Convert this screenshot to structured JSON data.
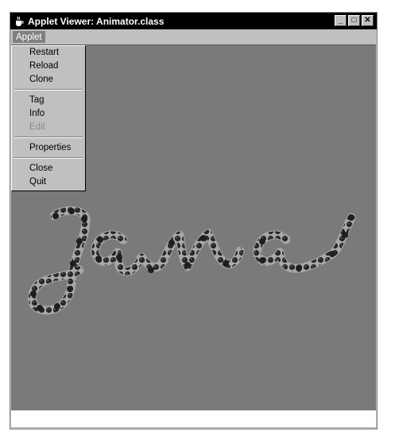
{
  "window": {
    "title": "Applet Viewer: Animator.class",
    "icon": "java-cup-icon",
    "controls": {
      "minimize": "_",
      "maximize": "□",
      "close": "✕"
    }
  },
  "menubar": {
    "items": [
      "Applet"
    ]
  },
  "applet_menu": {
    "items": [
      {
        "label": "Restart",
        "enabled": true
      },
      {
        "label": "Reload",
        "enabled": true
      },
      {
        "label": "Clone",
        "enabled": true
      },
      {
        "label": "Tag",
        "enabled": true
      },
      {
        "label": "Info",
        "enabled": true
      },
      {
        "label": "Edit",
        "enabled": false
      },
      {
        "label": "Properties",
        "enabled": true
      },
      {
        "label": "Close",
        "enabled": true
      },
      {
        "label": "Quit",
        "enabled": true
      }
    ]
  },
  "applet": {
    "background_color": "#7a7a7a",
    "animation_word": "Java",
    "stroke_color": "#2a2a2a"
  },
  "status": {
    "text": ""
  }
}
